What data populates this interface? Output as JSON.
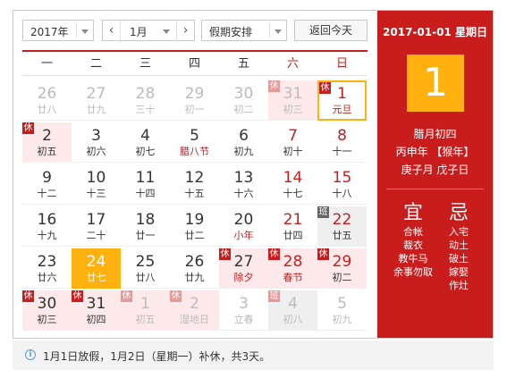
{
  "toolbar": {
    "year": "2017年",
    "prev": "‹",
    "month": "1月",
    "next": "›",
    "holiday": "假期安排",
    "today": "返回今天"
  },
  "weekdays": [
    "一",
    "二",
    "三",
    "四",
    "五",
    "六",
    "日"
  ],
  "days": [
    [
      {
        "n": "26",
        "l": "廿八",
        "dim": true
      },
      {
        "n": "27",
        "l": "廿九",
        "dim": true
      },
      {
        "n": "28",
        "l": "三十",
        "dim": true
      },
      {
        "n": "29",
        "l": "初一",
        "dim": true
      },
      {
        "n": "30",
        "l": "初二",
        "dim": true
      },
      {
        "n": "31",
        "l": "初三",
        "dim": true,
        "tag": "休",
        "rest": true,
        "wkend": true
      },
      {
        "n": "1",
        "l": "元旦",
        "tag": "休",
        "rest": true,
        "wkend": true,
        "fest": true,
        "selected": true
      }
    ],
    [
      {
        "n": "2",
        "l": "初五",
        "tag": "休",
        "rest": true
      },
      {
        "n": "3",
        "l": "初六"
      },
      {
        "n": "4",
        "l": "初七"
      },
      {
        "n": "5",
        "l": "腊八节",
        "fest": true
      },
      {
        "n": "6",
        "l": "初九"
      },
      {
        "n": "7",
        "l": "初十",
        "wkend": true
      },
      {
        "n": "8",
        "l": "十一",
        "wkend": true
      }
    ],
    [
      {
        "n": "9",
        "l": "十二"
      },
      {
        "n": "10",
        "l": "十三"
      },
      {
        "n": "11",
        "l": "十四"
      },
      {
        "n": "12",
        "l": "十五"
      },
      {
        "n": "13",
        "l": "十六"
      },
      {
        "n": "14",
        "l": "十七",
        "wkend": true
      },
      {
        "n": "15",
        "l": "十八",
        "wkend": true
      }
    ],
    [
      {
        "n": "16",
        "l": "十九"
      },
      {
        "n": "17",
        "l": "二十"
      },
      {
        "n": "18",
        "l": "廿一"
      },
      {
        "n": "19",
        "l": "廿二"
      },
      {
        "n": "20",
        "l": "小年",
        "fest": true
      },
      {
        "n": "21",
        "l": "廿四",
        "wkend": true
      },
      {
        "n": "22",
        "l": "廿五",
        "tag": "班",
        "work": true,
        "wkend": true
      }
    ],
    [
      {
        "n": "23",
        "l": "廿六"
      },
      {
        "n": "24",
        "l": "廿七",
        "today": true
      },
      {
        "n": "25",
        "l": "廿八"
      },
      {
        "n": "26",
        "l": "廿九"
      },
      {
        "n": "27",
        "l": "除夕",
        "tag": "休",
        "rest": true,
        "fest": true
      },
      {
        "n": "28",
        "l": "春节",
        "tag": "休",
        "rest": true,
        "wkend": true,
        "fest": true
      },
      {
        "n": "29",
        "l": "初二",
        "tag": "休",
        "rest": true,
        "wkend": true
      }
    ],
    [
      {
        "n": "30",
        "l": "初三",
        "tag": "休",
        "rest": true
      },
      {
        "n": "31",
        "l": "初四",
        "tag": "休",
        "rest": true
      },
      {
        "n": "1",
        "l": "初五",
        "tag": "休",
        "rest": true,
        "dim": true
      },
      {
        "n": "2",
        "l": "湿地日",
        "tag": "休",
        "rest": true,
        "dim": true
      },
      {
        "n": "3",
        "l": "立春",
        "dim": true
      },
      {
        "n": "4",
        "l": "初八",
        "tag": "班",
        "work": true,
        "dim": true
      },
      {
        "n": "5",
        "l": "初九",
        "dim": true
      }
    ]
  ],
  "panel": {
    "date": "2017-01-01 星期日",
    "big_day": "1",
    "lunar": "腊月初四",
    "ganzhi_year": "丙申年 【猴年】",
    "ganzhi_month_day": "庚子月 戊子日",
    "yi_label": "宜",
    "yi": [
      "合帐",
      "裁衣",
      "教牛马",
      "余事勿取"
    ],
    "ji_label": "忌",
    "ji": [
      "入宅",
      "动土",
      "破土",
      "嫁娶",
      "作灶"
    ]
  },
  "footer": {
    "info": "i",
    "message": "1月1日放假，1月2日（星期一）补休，共3天。"
  },
  "colors": {
    "accent": "#c91d1d",
    "today": "#ffb10f",
    "rest_bg": "#fde9e9",
    "work_tag": "#666666"
  }
}
